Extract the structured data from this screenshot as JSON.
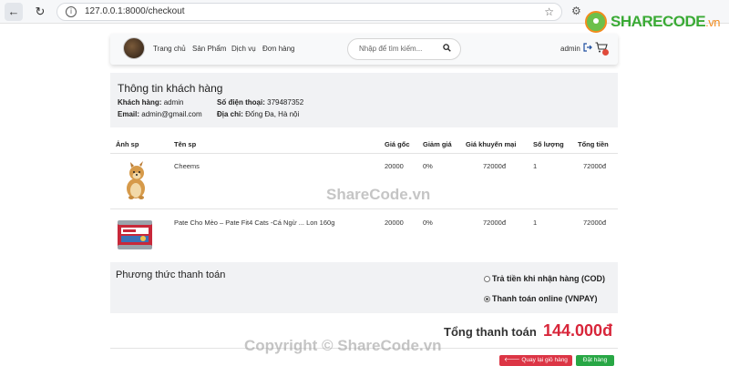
{
  "browser": {
    "url": "127.0.0.1:8000/checkout"
  },
  "watermark": {
    "logo_main": "SHARECODE",
    "logo_suffix": ".vn",
    "center": "ShareCode.vn",
    "bottom": "Copyright © ShareCode.vn"
  },
  "navbar": {
    "links": [
      "Trang chủ",
      "Sản Phẩm",
      "Dịch vụ",
      "Đơn hàng"
    ],
    "search_placeholder": "Nhập để tìm kiếm...",
    "user": "admin"
  },
  "customer": {
    "title": "Thông tin khách hàng",
    "name_label": "Khách hàng:",
    "name": "admin",
    "phone_label": "Số điện thoại:",
    "phone": "379487352",
    "email_label": "Email:",
    "email": "admin@gmail.com",
    "address_label": "Địa chỉ:",
    "address": "Đống Đa, Hà nội"
  },
  "table": {
    "headers": [
      "Ảnh sp",
      "Tên sp",
      "Giá gốc",
      "Giảm giá",
      "Giá khuyến mại",
      "Số lượng",
      "Tổng tiền"
    ],
    "rows": [
      {
        "image": "dog-image",
        "name": "Cheems",
        "price": "20000",
        "discount": "0%",
        "sale_price": "72000đ",
        "qty": "1",
        "total": "72000đ"
      },
      {
        "image": "pate-can-image",
        "name": "Pate Cho Mèo – Pate Fit4 Cats -Cá Ngừ ... Lon 160g",
        "price": "20000",
        "discount": "0%",
        "sale_price": "72000đ",
        "qty": "1",
        "total": "72000đ"
      }
    ]
  },
  "payment": {
    "title": "Phương thức thanh toán",
    "options": [
      {
        "label": "Trả tiền khi nhận hàng (COD)",
        "checked": false
      },
      {
        "label": "Thanh toán online (VNPAY)",
        "checked": true
      }
    ]
  },
  "summary": {
    "total_label": "Tổng thanh toán",
    "total_value": "144.000đ"
  },
  "actions": {
    "back_label": "Quay lại giỏ hàng",
    "order_label": "Đặt hàng"
  },
  "colors": {
    "accent_total": "#d8263a",
    "button_back": "#dc3545",
    "button_order": "#28a745"
  }
}
